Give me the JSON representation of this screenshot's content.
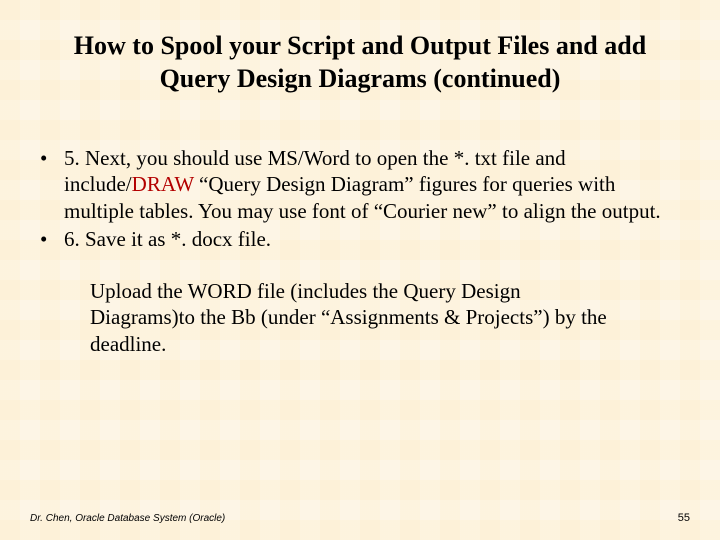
{
  "title": "How to Spool your Script and Output Files and add Query Design Diagrams (continued)",
  "bullets": {
    "item1_pre": " 5. Next, you should use MS/Word to open the *. txt file and include/",
    "item1_draw": "DRAW",
    "item1_post": " “Query Design Diagram” figures for queries with multiple tables. You may use font of  “Courier new” to align the output.",
    "item2": "6. Save it as *. docx file."
  },
  "upload": "Upload the WORD file (includes the Query Design Diagrams)to the Bb (under “Assignments & Projects”) by the deadline.",
  "footer_left": "Dr. Chen, Oracle Database System (Oracle)",
  "footer_right": "55"
}
